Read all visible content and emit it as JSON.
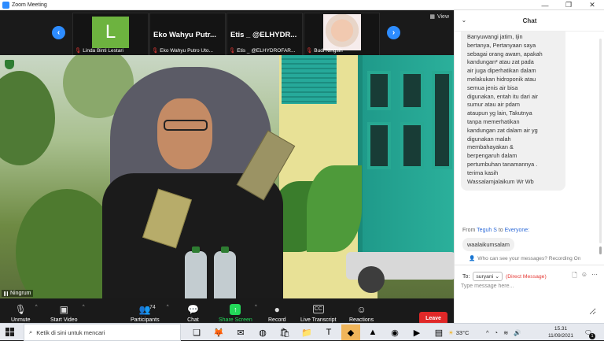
{
  "window": {
    "title": "Zoom Meeting",
    "controls": [
      "—",
      "❐",
      "✕"
    ]
  },
  "strip": {
    "prev_icon": "chevron-left-icon",
    "next_icon": "chevron-right-icon",
    "view_label": "View",
    "thumbnails": [
      {
        "name": "Linda Binti Lestari",
        "avatar_letter": "L",
        "avatar_color": "#6db33f"
      },
      {
        "name": "Eko Wahyu Putro Uto...",
        "big_name": "Eko Wahyu Putr..."
      },
      {
        "name": "Etis _ @ELHYDROFAR...",
        "big_name": "Etis _ @ELHYDR..."
      },
      {
        "name": "Budi Ningsih"
      }
    ]
  },
  "speaker": {
    "name": "Ningrum"
  },
  "toolbar": {
    "unmute": "Unmute",
    "start_video": "Start Video",
    "participants": "Participants",
    "participants_count": "74",
    "chat": "Chat",
    "share_screen": "Share Screen",
    "record": "Record",
    "live_transcript": "Live Transcript",
    "reactions": "Reactions",
    "leave": "Leave",
    "leave_color": "#e02828",
    "share_color": "#23d959"
  },
  "chat": {
    "header": "Chat",
    "message_lines": [
      "Banyuwangi jatim, Ijin",
      "bertanya, Pertanyaan saya",
      "sebagai orang awam, apakah",
      "kandungan² atau zat pada",
      "air juga diperhatikan dalam",
      "melakukan hidroponik atau",
      "semua jenis air bisa",
      "digunakan, entah itu dari air",
      "sumur atau air pdam",
      "ataupun yg lain, Takutnya",
      "tanpa memerhatikan",
      "kandungan zat dalam air yg",
      "digunakan malah",
      "membahayakan &",
      "berpengaruh dalam",
      "pertumbuhan tanamannya .",
      "terima kasih",
      "Wassalamjalaikum Wr Wb"
    ],
    "from_prefix": "From",
    "from_name": "Teguh S",
    "to_word": "to",
    "to_name": "Everyone:",
    "reply": "waalaikumsalam",
    "who_can_see": "Who can see your messages? Recording On",
    "to_label": "To:",
    "recipient": "suryani",
    "direct_message": "(Direct Message)",
    "placeholder": "Type message here..."
  },
  "taskbar": {
    "search_placeholder": "Ketik di sini untuk mencari",
    "temperature": "33°C",
    "time": "15.31",
    "date": "11/09/2021",
    "notifications": "1",
    "accent": "#f0b55a"
  }
}
